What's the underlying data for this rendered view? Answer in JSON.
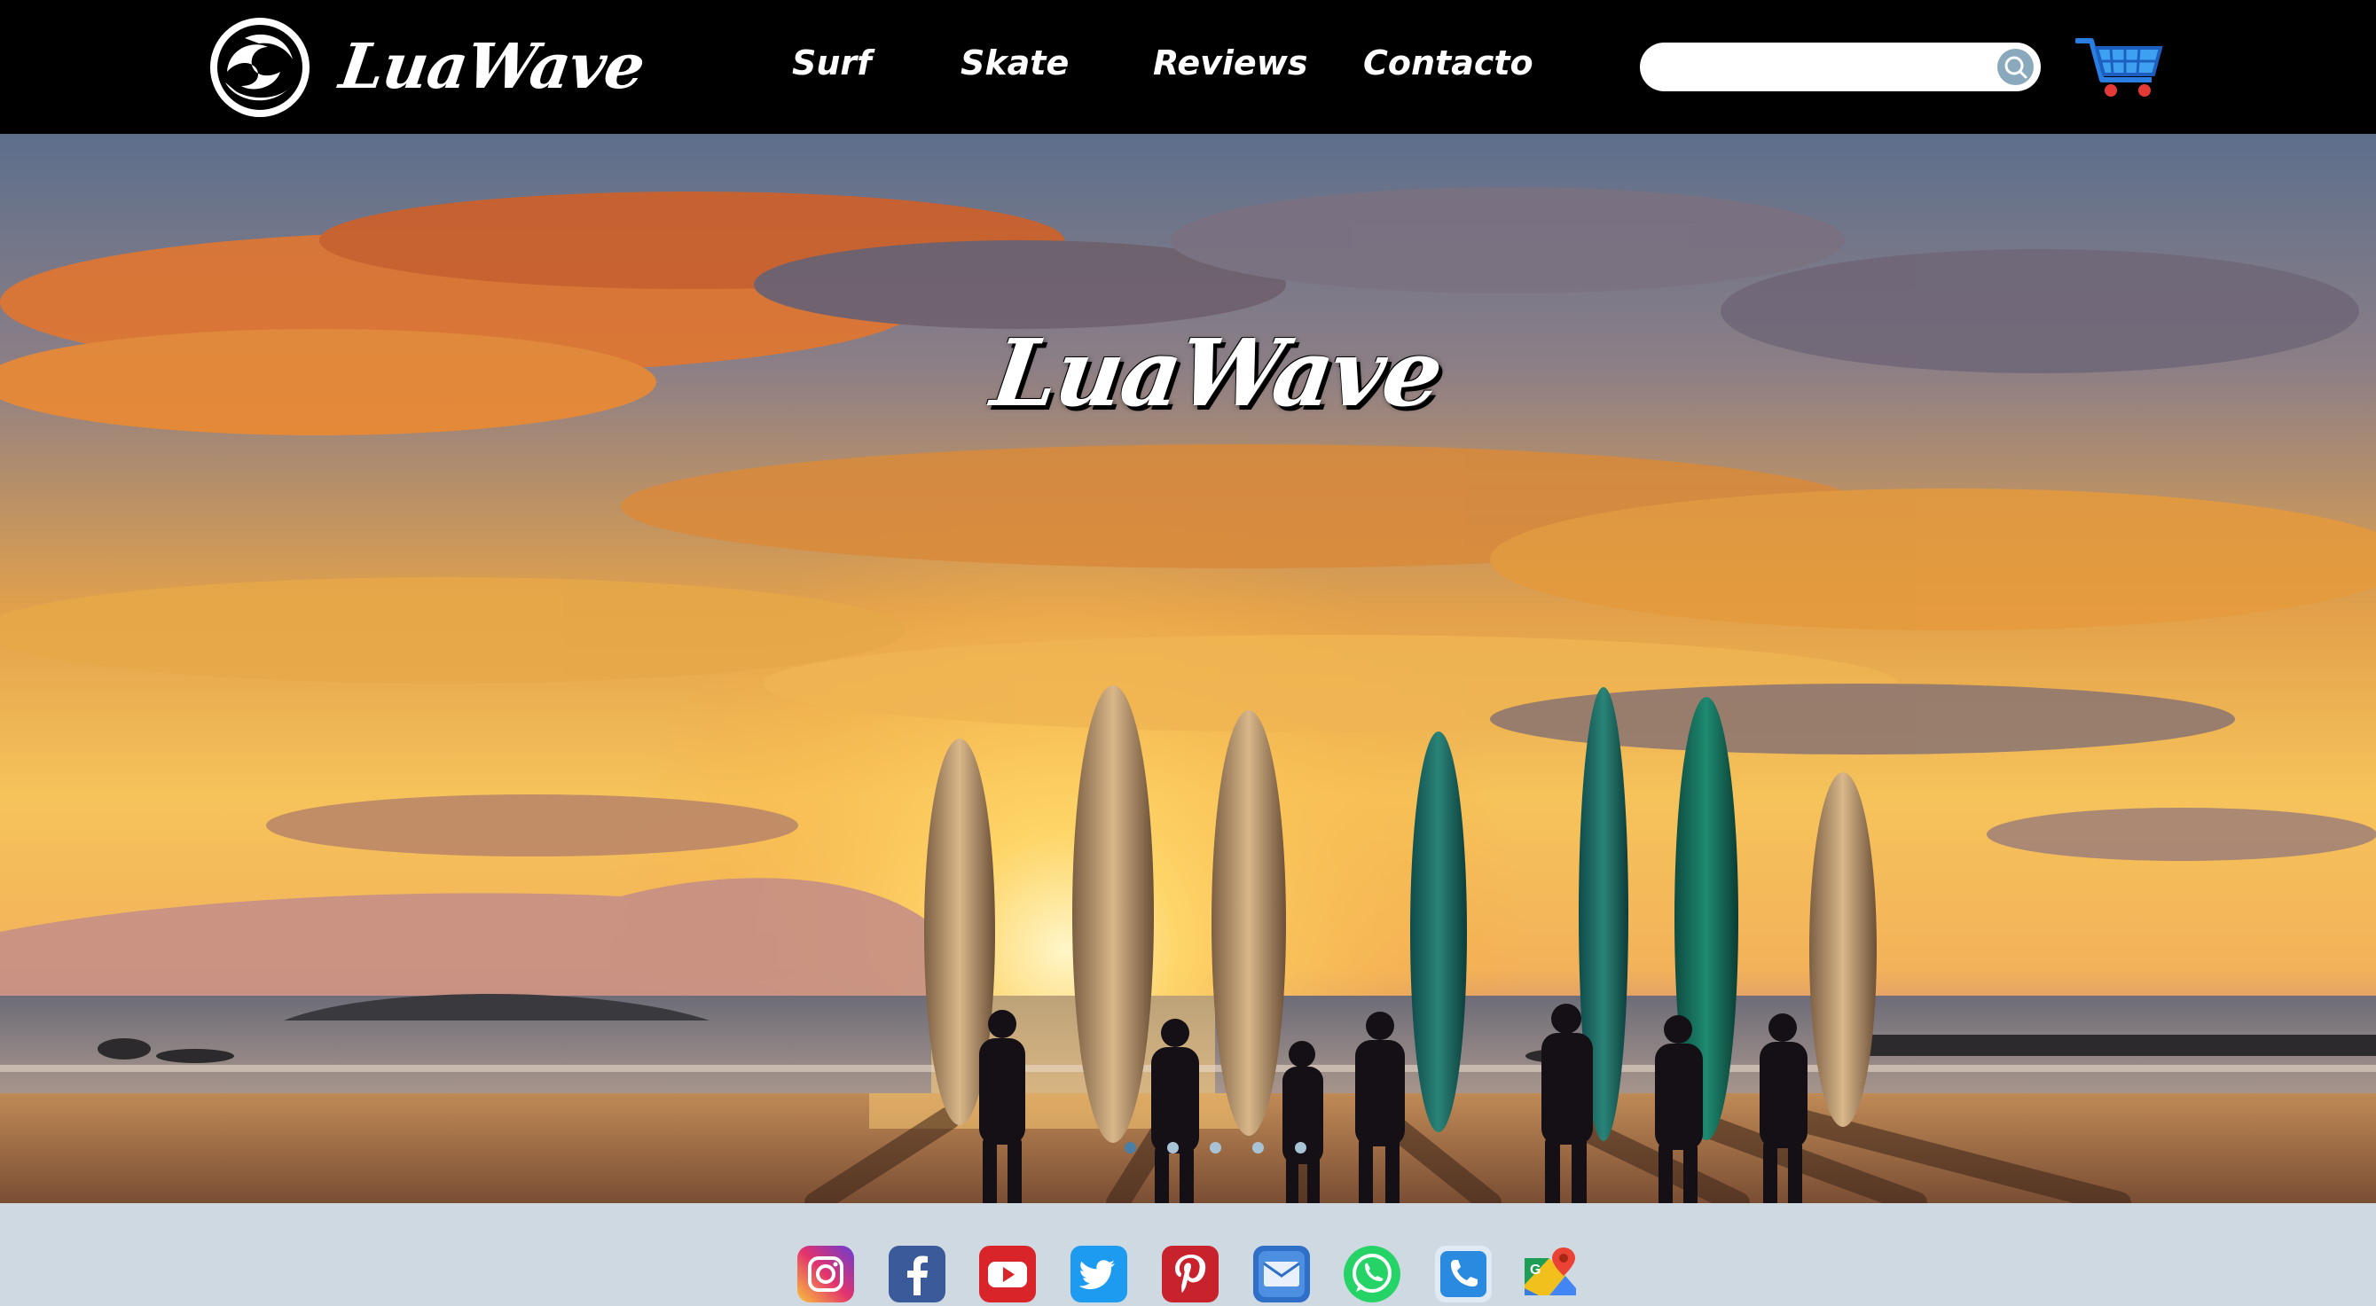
{
  "header": {
    "brand": "LuaWave",
    "logo_icon": "wave-circle-icon",
    "nav": [
      {
        "label": "Surf"
      },
      {
        "label": "Skate"
      },
      {
        "label": "Reviews"
      },
      {
        "label": "Contacto"
      }
    ],
    "search": {
      "value": "",
      "placeholder": "",
      "icon": "search-icon"
    },
    "cart_icon": "shopping-cart-icon"
  },
  "hero": {
    "title": "LuaWave",
    "slides": 5,
    "active_slide": 1
  },
  "footer": {
    "social": [
      {
        "name": "instagram-icon"
      },
      {
        "name": "facebook-icon"
      },
      {
        "name": "youtube-icon"
      },
      {
        "name": "twitter-icon"
      },
      {
        "name": "pinterest-icon"
      },
      {
        "name": "email-icon"
      },
      {
        "name": "whatsapp-icon"
      },
      {
        "name": "phone-icon"
      },
      {
        "name": "google-maps-icon"
      }
    ]
  },
  "colors": {
    "header_bg": "#000000",
    "footer_bg": "#cfd9e1",
    "search_button": "#8aa9bd",
    "dot": "#a9c3d6"
  }
}
